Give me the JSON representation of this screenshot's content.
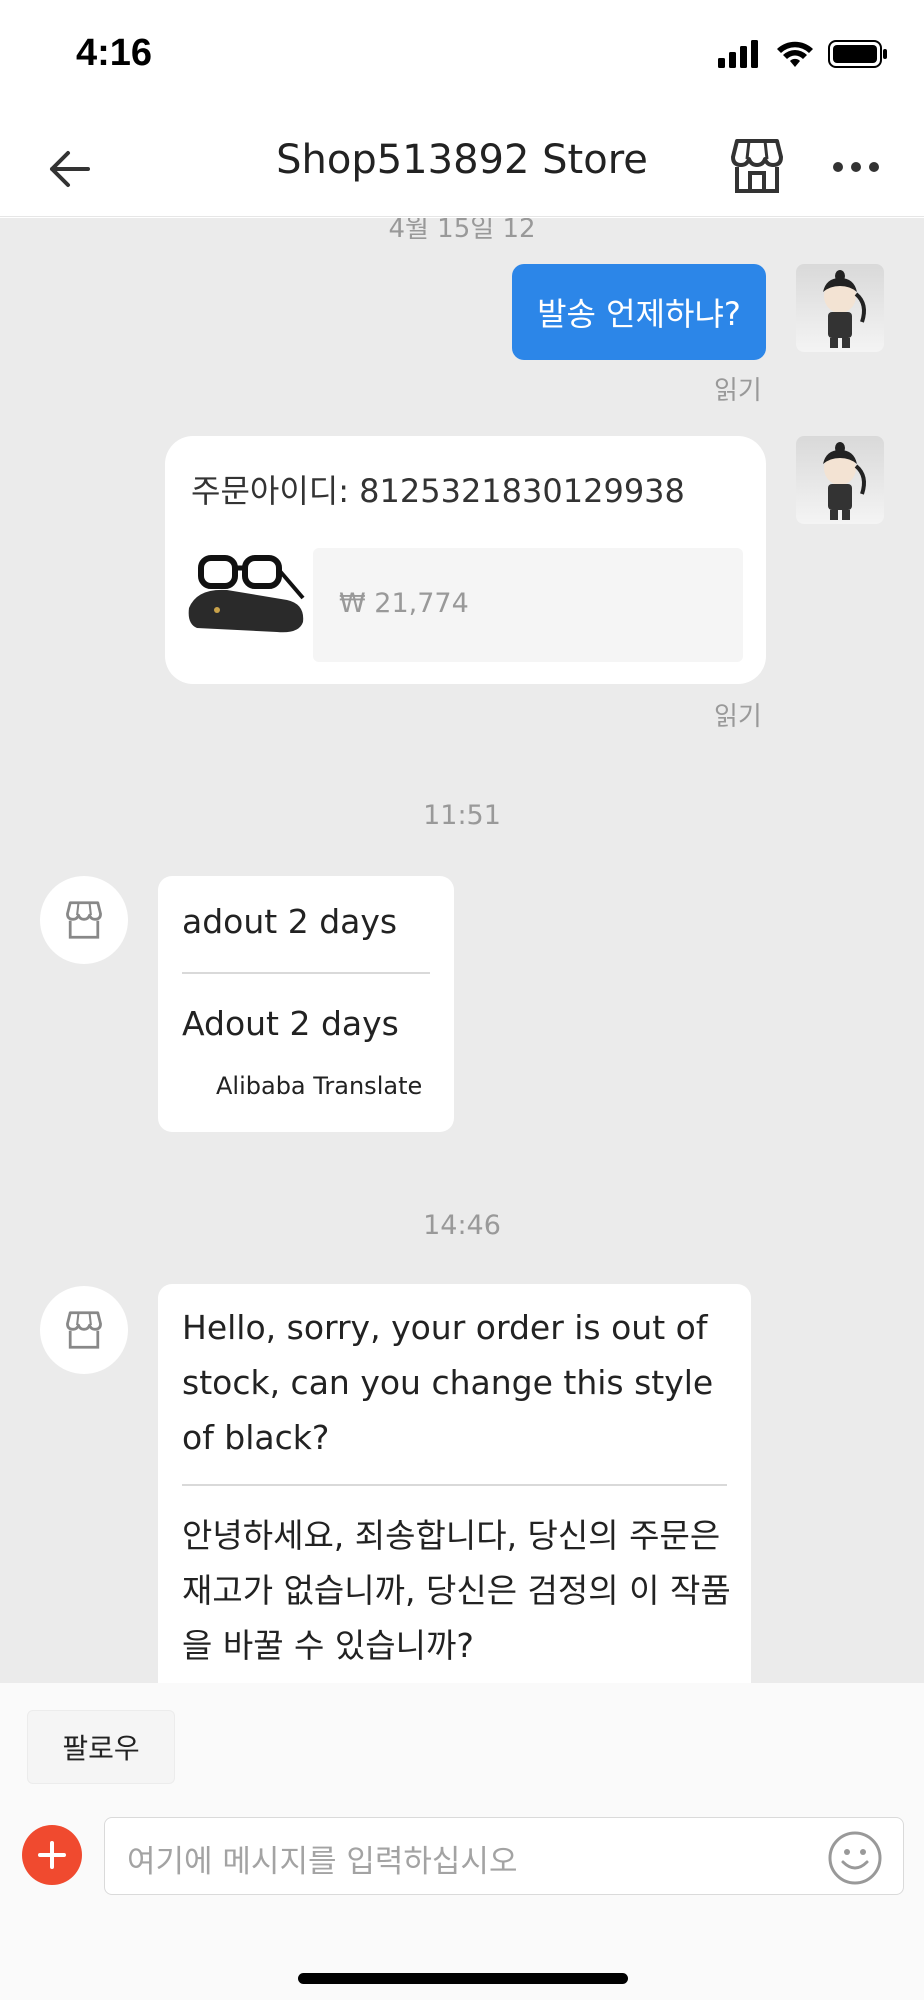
{
  "status_bar": {
    "time": "4:16"
  },
  "nav": {
    "title": "Shop513892 Store"
  },
  "chat": {
    "cut_date": "4월 15일 12",
    "messages": {
      "user_text": "발송 언제하냐?",
      "user_text_status": "읽기",
      "order_id_label": "주문아이디: 8125321830129938",
      "order_price": "₩ 21,774",
      "order_status": "읽기",
      "time_1": "11:51",
      "shop_reply_1_original": "adout 2 days",
      "shop_reply_1_translated": "Adout 2 days",
      "translate_credit": "Alibaba Translate",
      "time_2": "14:46",
      "shop_reply_2_original": "Hello, sorry, your order is out of stock, can you change this style of black?",
      "shop_reply_2_translated": "안녕하세요, 죄송합니다, 당신의 주문은 재고가 없습니까, 당신은 검정의 이 작품을 바꿀 수 있습니까?"
    }
  },
  "bottom": {
    "follow_label": "팔로우",
    "input_placeholder": "여기에 메시지를 입력하십시오"
  },
  "colors": {
    "accent_blue": "#2c86e8",
    "plus_red": "#f04a2f",
    "chat_bg": "#ebebeb"
  },
  "icons": [
    "back-arrow-icon",
    "store-icon",
    "more-icon",
    "plus-icon",
    "emoji-icon",
    "signal-icon",
    "wifi-icon",
    "battery-icon"
  ]
}
